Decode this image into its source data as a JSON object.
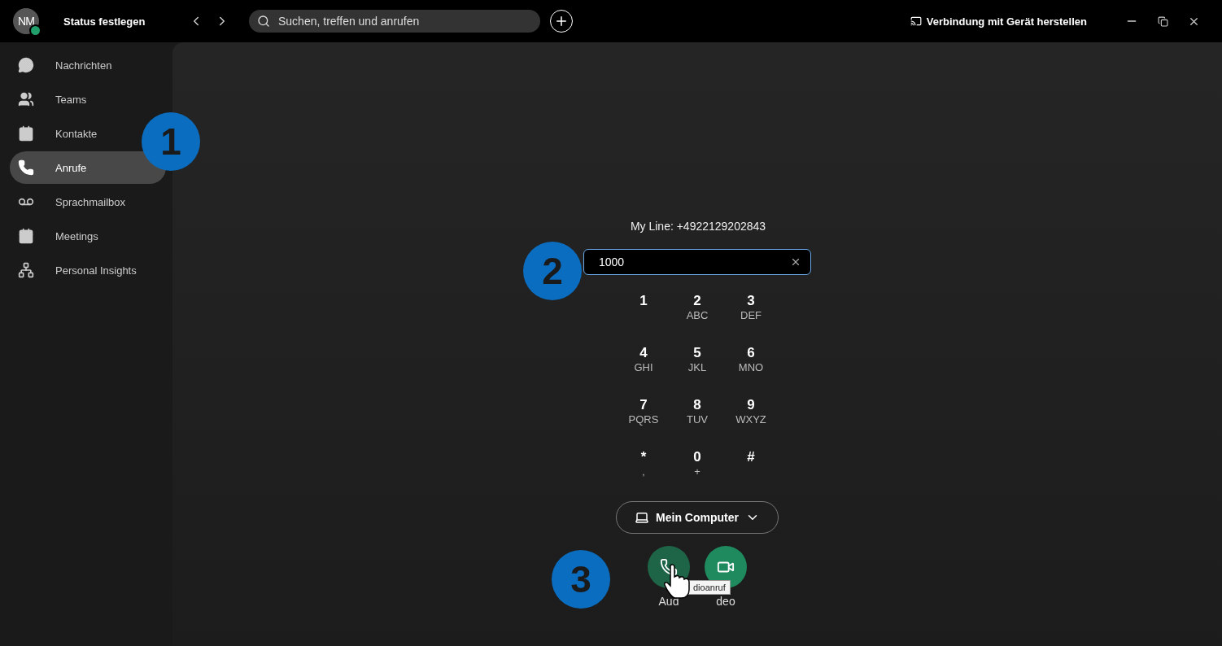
{
  "profile": {
    "initials": "NM"
  },
  "status_label": "Status festlegen",
  "search": {
    "placeholder": "Suchen, treffen und anrufen"
  },
  "device_link": "Verbindung mit Gerät herstellen",
  "sidebar": {
    "items": [
      {
        "label": "Nachrichten",
        "selected": false
      },
      {
        "label": "Teams",
        "selected": false
      },
      {
        "label": "Kontakte",
        "selected": false
      },
      {
        "label": "Anrufe",
        "selected": true
      },
      {
        "label": "Sprachmailbox",
        "selected": false
      },
      {
        "label": "Meetings",
        "selected": false
      },
      {
        "label": "Personal Insights",
        "selected": false
      }
    ]
  },
  "dialer": {
    "my_line": "My Line: +4922129202843",
    "input": {
      "value": "1000"
    },
    "keys": [
      {
        "digit": "1"
      },
      {
        "digit": "2",
        "letters": "ABC"
      },
      {
        "digit": "3",
        "letters": "DEF"
      },
      {
        "digit": "4",
        "letters": "GHI"
      },
      {
        "digit": "5",
        "letters": "JKL"
      },
      {
        "digit": "6",
        "letters": "MNO"
      },
      {
        "digit": "7",
        "letters": "PQRS"
      },
      {
        "digit": "8",
        "letters": "TUV"
      },
      {
        "digit": "9",
        "letters": "WXYZ"
      },
      {
        "digit": "*",
        "letters": "‚"
      },
      {
        "digit": "0",
        "letters": "+"
      },
      {
        "digit": "#"
      }
    ],
    "device": "Mein Computer",
    "call_buttons": [
      {
        "kind": "audio",
        "label": "Aud"
      },
      {
        "kind": "video",
        "label": "deo"
      }
    ],
    "tooltip": "dioanruf"
  },
  "annotations": [
    "1",
    "2",
    "3"
  ]
}
